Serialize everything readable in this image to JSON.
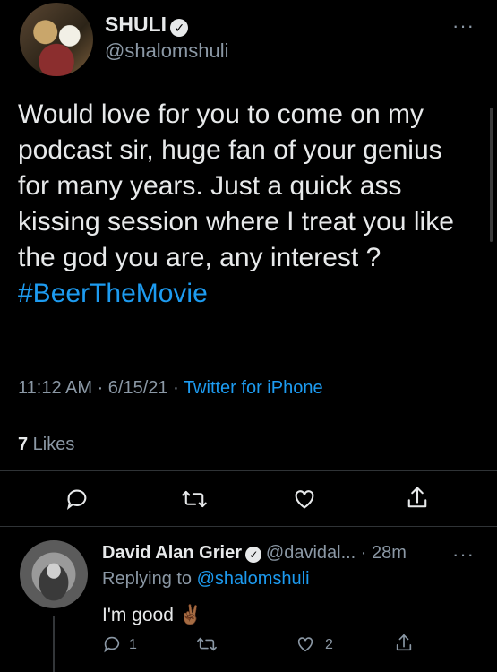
{
  "tweet": {
    "name": "SHULI",
    "handle": "@shalomshuli",
    "text": "Would love for you to come on my podcast sir, huge fan of your genius for many years. Just a quick ass kissing session where I treat you like the god you are, any interest ?",
    "hashtag": "#BeerTheMovie",
    "time": "11:12 AM · 6/15/21 · ",
    "source": "Twitter for iPhone",
    "likes_count": "7",
    "likes_label": " Likes",
    "more": "···"
  },
  "reply": {
    "name": "David Alan Grier",
    "handle": "@davidal...",
    "time": " · 28m",
    "replying_prefix": "Replying to ",
    "replying_to": "@shalomshuli",
    "text": "I'm good ✌🏾",
    "reply_count": "1",
    "like_count": "2",
    "more": "···"
  },
  "icons": {
    "reply": "reply-icon",
    "retweet": "retweet-icon",
    "like": "heart-icon",
    "share": "share-icon",
    "verified": "verified-badge-icon",
    "more": "more-icon"
  },
  "colors": {
    "background": "#000000",
    "text": "#e7e9ea",
    "secondary": "#8b98a5",
    "link": "#1d9bf0",
    "divider": "#2f3336"
  }
}
